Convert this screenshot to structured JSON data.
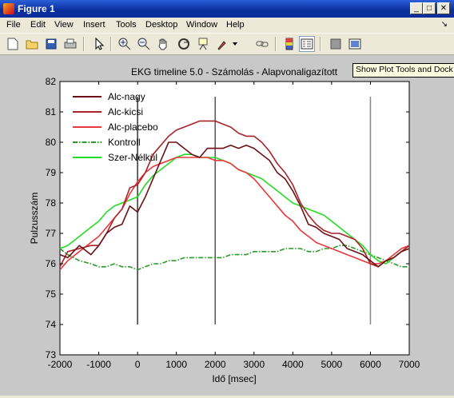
{
  "window": {
    "title": "Figure 1",
    "minimize": "_",
    "maximize": "□",
    "close": "✕"
  },
  "menu": [
    "File",
    "Edit",
    "View",
    "Insert",
    "Tools",
    "Desktop",
    "Window",
    "Help"
  ],
  "menu_arrow": "↘",
  "toolbar": {
    "icons": [
      "new-file-icon",
      "open-folder-icon",
      "save-icon",
      "print-icon",
      "pointer-icon",
      "zoom-in-icon",
      "zoom-out-icon",
      "pan-hand-icon",
      "rotate-3d-icon",
      "data-cursor-icon",
      "brush-icon",
      "link-icon",
      "colorbar-icon",
      "legend-icon",
      "hide-plot-tools-icon",
      "show-plot-tools-icon"
    ]
  },
  "tooltip": "Show Plot Tools and Dock",
  "colors": {
    "alc_nagy": "#6b1116",
    "alc_kicsi": "#a8232a",
    "alc_placebo": "#e8383b",
    "kontroll": "#2a9a2a",
    "szer_nelkul": "#22dd22"
  },
  "chart_data": {
    "type": "line",
    "title": "EKG timeline 5.0 - Számolás - Alapvonaligazított",
    "xlabel": "Idő [msec]",
    "ylabel": "Pulzusszám",
    "xlim": [
      -2000,
      7000
    ],
    "ylim": [
      73,
      82
    ],
    "xticks": [
      "-2000",
      "-1000",
      "0",
      "1000",
      "2000",
      "3000",
      "4000",
      "5000",
      "6000",
      "7000"
    ],
    "yticks": [
      "73",
      "74",
      "75",
      "76",
      "77",
      "78",
      "79",
      "80",
      "81",
      "82"
    ],
    "legend_position": "top-left",
    "vlines": [
      {
        "x": 0,
        "y": [
          74,
          81.5
        ]
      },
      {
        "x": 2000,
        "y": [
          74,
          81.5
        ]
      },
      {
        "x": 6000,
        "y": [
          74,
          81.5
        ]
      }
    ],
    "series": [
      {
        "name": "Alc-nagy",
        "style": "solid",
        "x": [
          -2000,
          -1800,
          -1500,
          -1200,
          -1000,
          -800,
          -600,
          -400,
          -200,
          0,
          200,
          400,
          600,
          800,
          1000,
          1200,
          1400,
          1600,
          1800,
          2000,
          2200,
          2400,
          2600,
          2800,
          3000,
          3200,
          3400,
          3600,
          3800,
          4000,
          4200,
          4400,
          4600,
          4800,
          5000,
          5200,
          5400,
          5600,
          5800,
          6000,
          6200,
          6400,
          6600,
          6800,
          7000
        ],
        "y": [
          76.3,
          76.2,
          76.6,
          76.3,
          76.6,
          77.0,
          77.2,
          77.3,
          77.9,
          77.7,
          78.2,
          78.8,
          79.4,
          80.0,
          80.0,
          79.8,
          79.6,
          79.5,
          79.8,
          79.8,
          79.8,
          79.9,
          79.8,
          79.9,
          79.8,
          79.6,
          79.4,
          79.0,
          78.8,
          78.4,
          77.9,
          77.3,
          77.2,
          77.0,
          76.9,
          76.8,
          76.5,
          76.4,
          76.3,
          76.1,
          75.9,
          76.1,
          76.2,
          76.4,
          76.5
        ]
      },
      {
        "name": "Alc-kicsi",
        "style": "solid",
        "x": [
          -2000,
          -1800,
          -1500,
          -1200,
          -1000,
          -800,
          -600,
          -400,
          -200,
          0,
          200,
          400,
          600,
          800,
          1000,
          1200,
          1400,
          1600,
          1800,
          2000,
          2200,
          2400,
          2600,
          2800,
          3000,
          3200,
          3400,
          3600,
          3800,
          4000,
          4200,
          4400,
          4600,
          4800,
          5000,
          5200,
          5400,
          5600,
          5800,
          6000,
          6200,
          6400,
          6600,
          6800,
          7000
        ],
        "y": [
          75.9,
          76.4,
          76.5,
          76.6,
          76.6,
          77.0,
          77.5,
          77.8,
          78.5,
          78.6,
          79.0,
          79.6,
          79.9,
          80.2,
          80.4,
          80.5,
          80.6,
          80.7,
          80.7,
          80.7,
          80.6,
          80.5,
          80.3,
          80.2,
          80.2,
          80.0,
          79.7,
          79.3,
          79.0,
          78.6,
          78.0,
          77.6,
          77.3,
          77.1,
          77.0,
          77.0,
          76.9,
          76.8,
          76.5,
          76.0,
          75.9,
          76.1,
          76.2,
          76.4,
          76.6
        ]
      },
      {
        "name": "Alc-placebo",
        "style": "solid",
        "x": [
          -2000,
          -1800,
          -1500,
          -1200,
          -1000,
          -800,
          -600,
          -400,
          -200,
          0,
          200,
          400,
          600,
          800,
          1000,
          1200,
          1400,
          1600,
          1800,
          2000,
          2200,
          2400,
          2600,
          2800,
          3000,
          3200,
          3400,
          3600,
          3800,
          4000,
          4200,
          4400,
          4600,
          4800,
          5000,
          5200,
          5400,
          5600,
          5800,
          6000,
          6200,
          6400,
          6600,
          6800,
          7000
        ],
        "y": [
          75.8,
          76.1,
          76.4,
          76.7,
          76.9,
          77.2,
          77.5,
          77.8,
          78.3,
          78.7,
          79.0,
          79.2,
          79.3,
          79.4,
          79.5,
          79.5,
          79.5,
          79.5,
          79.5,
          79.4,
          79.4,
          79.3,
          79.1,
          79.0,
          78.8,
          78.5,
          78.2,
          77.9,
          77.6,
          77.4,
          77.1,
          76.9,
          76.7,
          76.6,
          76.5,
          76.4,
          76.3,
          76.2,
          76.1,
          76.0,
          76.0,
          76.1,
          76.3,
          76.5,
          76.6
        ]
      },
      {
        "name": "Kontroll",
        "style": "dashdot",
        "x": [
          -2000,
          -1800,
          -1500,
          -1200,
          -1000,
          -800,
          -600,
          -400,
          -200,
          0,
          200,
          400,
          600,
          800,
          1000,
          1200,
          1400,
          1600,
          1800,
          2000,
          2200,
          2400,
          2600,
          2800,
          3000,
          3200,
          3400,
          3600,
          3800,
          4000,
          4200,
          4400,
          4600,
          4800,
          5000,
          5200,
          5400,
          5600,
          5800,
          6000,
          6200,
          6400,
          6600,
          6800,
          7000
        ],
        "y": [
          76.5,
          76.3,
          76.1,
          76.0,
          75.9,
          75.9,
          76.0,
          75.9,
          75.9,
          75.8,
          75.9,
          76.0,
          76.0,
          76.1,
          76.1,
          76.2,
          76.2,
          76.2,
          76.2,
          76.2,
          76.2,
          76.3,
          76.3,
          76.3,
          76.4,
          76.4,
          76.4,
          76.4,
          76.5,
          76.5,
          76.5,
          76.4,
          76.4,
          76.5,
          76.5,
          76.6,
          76.6,
          76.5,
          76.4,
          76.3,
          76.2,
          76.1,
          76.0,
          75.9,
          75.9
        ]
      },
      {
        "name": "Szer-Nélkül",
        "style": "solid",
        "x": [
          -2000,
          -1800,
          -1500,
          -1200,
          -1000,
          -800,
          -600,
          -400,
          -200,
          0,
          200,
          400,
          600,
          800,
          1000,
          1200,
          1400,
          1600,
          1800,
          2000,
          2200,
          2400,
          2600,
          2800,
          3000,
          3200,
          3400,
          3600,
          3800,
          4000,
          4200,
          4400,
          4600,
          4800,
          5000,
          5200,
          5400,
          5600,
          5800,
          6000,
          6200,
          6400,
          6600,
          6800,
          7000
        ],
        "y": [
          76.5,
          76.6,
          76.9,
          77.2,
          77.4,
          77.7,
          77.9,
          78.0,
          78.1,
          78.2,
          78.6,
          78.9,
          79.1,
          79.3,
          79.5,
          79.6,
          79.6,
          79.5,
          79.5,
          79.5,
          79.4,
          79.3,
          79.1,
          79.0,
          78.9,
          78.8,
          78.6,
          78.4,
          78.2,
          78.0,
          77.9,
          77.8,
          77.7,
          77.6,
          77.4,
          77.2,
          77.0,
          76.8,
          76.6,
          76.3,
          76.1,
          76.0,
          76.2,
          76.4,
          76.5
        ]
      }
    ]
  }
}
